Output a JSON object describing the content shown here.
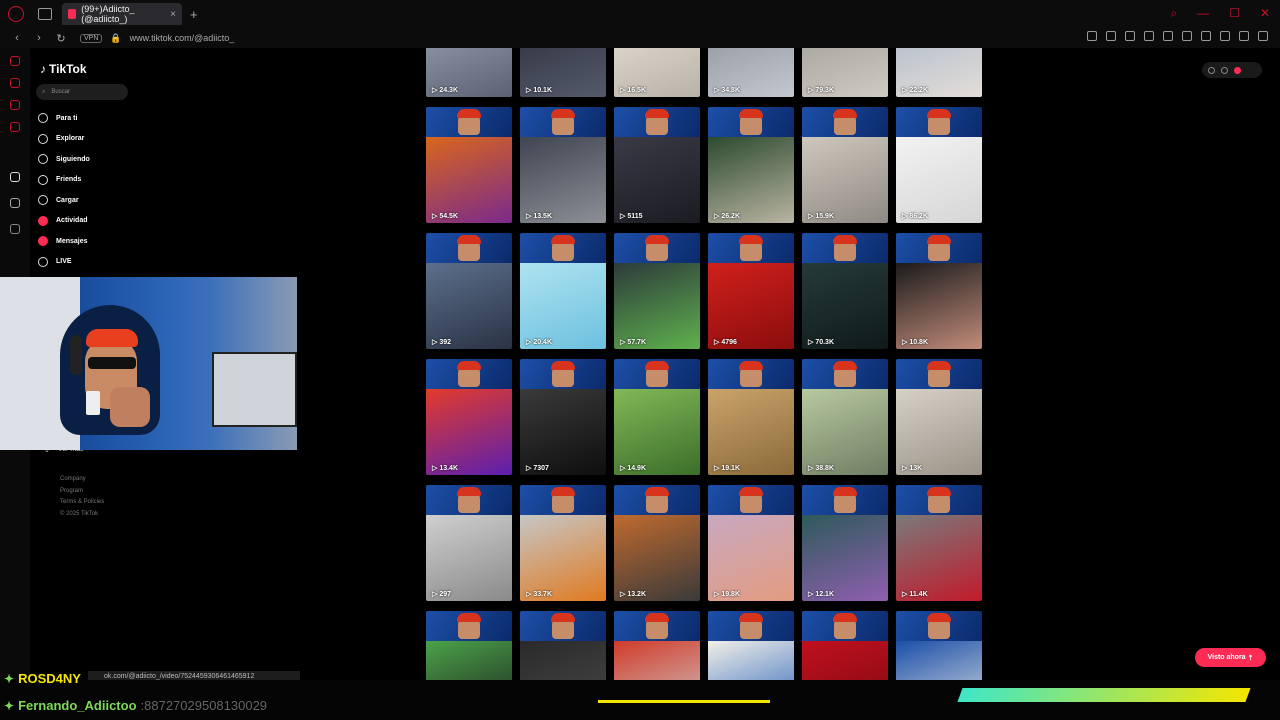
{
  "browser": {
    "tab_title": "(99+)Adiicto_ (@adiicto_)",
    "vpn_label": "VPN",
    "url": "www.tiktok.com/@adiicto_"
  },
  "sidebar": {
    "logo": "TikTok",
    "search_placeholder": "Buscar",
    "items": [
      {
        "label": "Para ti",
        "icon": "home-icon"
      },
      {
        "label": "Explorar",
        "icon": "compass-icon"
      },
      {
        "label": "Siguiendo",
        "icon": "following-icon"
      },
      {
        "label": "Friends",
        "icon": "friends-icon"
      },
      {
        "label": "Cargar",
        "icon": "upload-icon"
      },
      {
        "label": "Actividad",
        "icon": "activity-icon"
      },
      {
        "label": "Mensajes",
        "icon": "messages-icon"
      },
      {
        "label": "LIVE",
        "icon": "live-icon"
      }
    ],
    "more_label": "Ver más",
    "footer": [
      "Company",
      "Program",
      "Terms & Policies",
      "© 2025 TikTok"
    ]
  },
  "videos": [
    {
      "views": "24.3K"
    },
    {
      "views": "10.1K"
    },
    {
      "views": "16.5K"
    },
    {
      "views": "34.8K"
    },
    {
      "views": "79.3K"
    },
    {
      "views": "22.2K"
    },
    {
      "views": "54.5K"
    },
    {
      "views": "13.5K"
    },
    {
      "views": "5115"
    },
    {
      "views": "26.2K"
    },
    {
      "views": "15.9K"
    },
    {
      "views": "86.2K"
    },
    {
      "views": "392"
    },
    {
      "views": "20.4K"
    },
    {
      "views": "57.7K"
    },
    {
      "views": "4796"
    },
    {
      "views": "70.3K"
    },
    {
      "views": "10.8K"
    },
    {
      "views": "13.4K"
    },
    {
      "views": "7307"
    },
    {
      "views": "14.9K"
    },
    {
      "views": "19.1K"
    },
    {
      "views": "38.8K"
    },
    {
      "views": "13K"
    },
    {
      "views": "297"
    },
    {
      "views": "33.7K"
    },
    {
      "views": "13.2K"
    },
    {
      "views": "19.8K"
    },
    {
      "views": "12.1K"
    },
    {
      "views": "11.4K"
    },
    {
      "views": ""
    },
    {
      "views": ""
    },
    {
      "views": ""
    },
    {
      "views": ""
    },
    {
      "views": ""
    },
    {
      "views": ""
    }
  ],
  "visto_ahora": "Visto ahora",
  "status_url": "ok.com/@adiicto_/video/7524459306461465912",
  "chat": [
    {
      "user": "ROSD4NY",
      "message": ""
    },
    {
      "user": "Fernando_Adiictoo",
      "message": ":88727029508130029"
    }
  ]
}
